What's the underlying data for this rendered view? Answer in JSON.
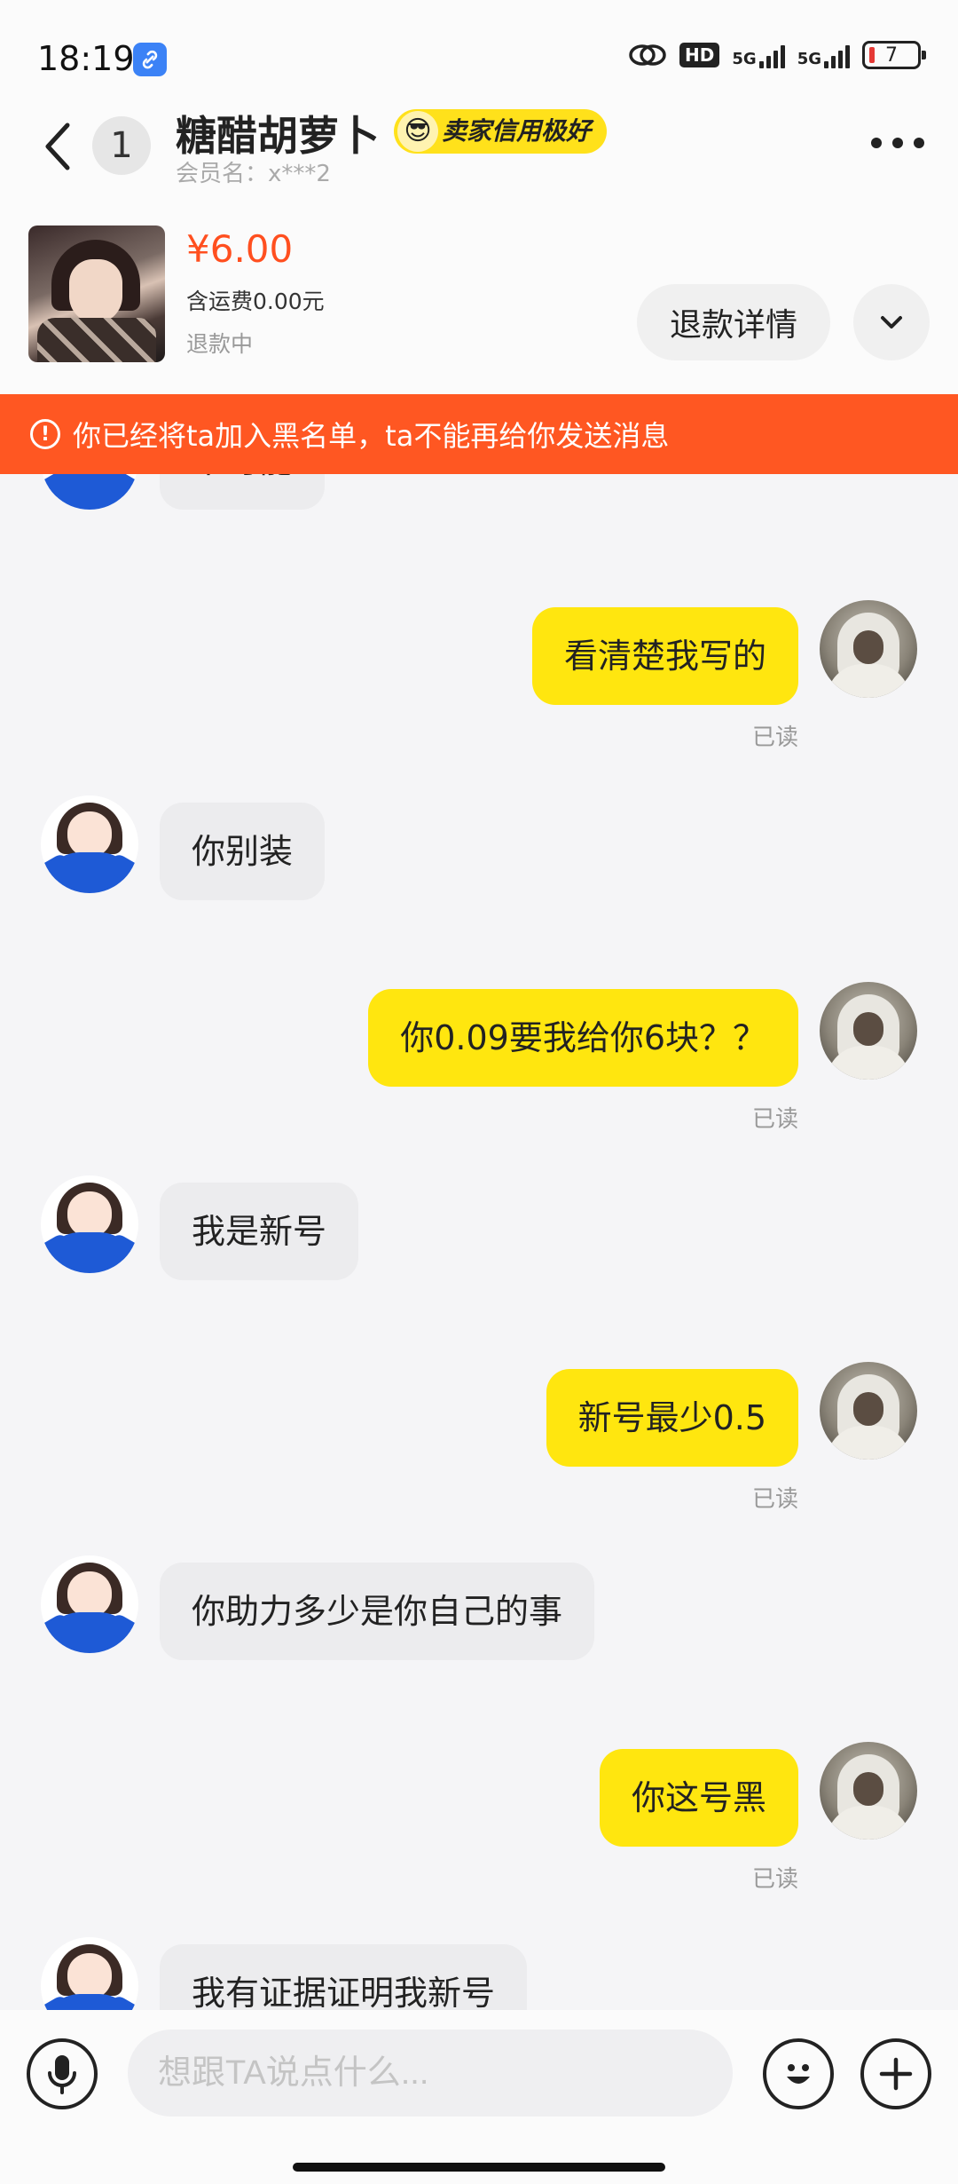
{
  "status_bar": {
    "time": "18:19",
    "hd_label": "HD",
    "network_1": "5G",
    "network_2": "5G",
    "battery": "7"
  },
  "header": {
    "unread_count": "1",
    "contact_name": "糖醋胡萝卜",
    "credit_badge": "卖家信用极好",
    "member_name": "会员名：x***2"
  },
  "product": {
    "price": "¥6.00",
    "shipping": "含运费0.00元",
    "status": "退款中",
    "refund_button": "退款详情"
  },
  "banner": {
    "text": "你已经将ta加入黑名单，ta不能再给你发送消息"
  },
  "messages": [
    {
      "from": "seller",
      "text": "不可能"
    },
    {
      "from": "me",
      "text": "看清楚我写的",
      "status": "已读"
    },
    {
      "from": "seller",
      "text": "你别装"
    },
    {
      "from": "me",
      "text": "你0.09要我给你6块？？",
      "status": "已读"
    },
    {
      "from": "seller",
      "text": "我是新号"
    },
    {
      "from": "me",
      "text": "新号最少0.5",
      "status": "已读"
    },
    {
      "from": "seller",
      "text": "你助力多少是你自己的事"
    },
    {
      "from": "me",
      "text": "你这号黑",
      "status": "已读"
    },
    {
      "from": "seller",
      "text": "我有证据证明我新号"
    }
  ],
  "input": {
    "placeholder": "想跟TA说点什么..."
  },
  "colors": {
    "accent_yellow": "#ffe60f",
    "price_orange": "#ff4f1f",
    "banner_orange": "#ff5722"
  },
  "icons": [
    "back-icon",
    "link-icon",
    "more-icon",
    "chevron-down-icon",
    "warning-icon",
    "microphone-icon",
    "emoji-icon",
    "plus-icon"
  ]
}
